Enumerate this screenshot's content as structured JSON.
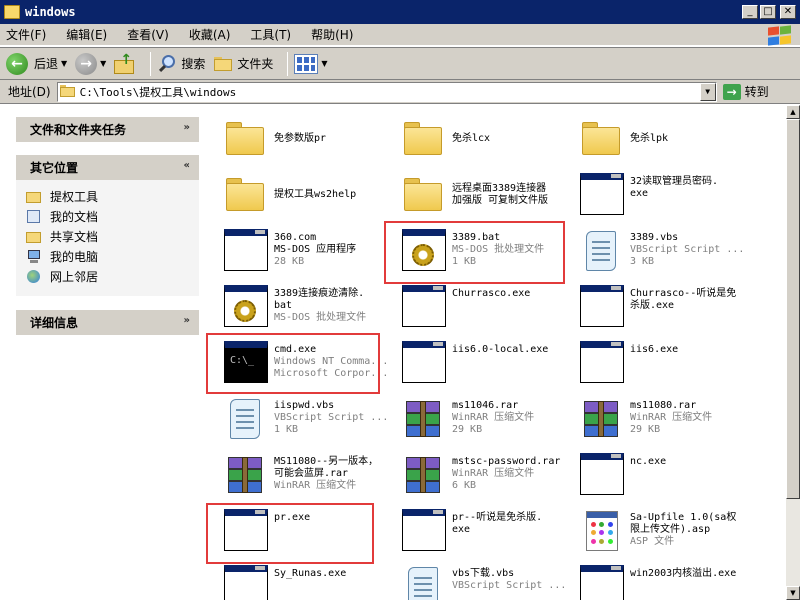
{
  "window": {
    "title": "windows"
  },
  "menu": [
    "文件(F)",
    "编辑(E)",
    "查看(V)",
    "收藏(A)",
    "工具(T)",
    "帮助(H)"
  ],
  "toolbar": {
    "back_label": "后退",
    "search_label": "搜索",
    "folders_label": "文件夹"
  },
  "address": {
    "label": "地址(D)",
    "value": "C:\\Tools\\提权工具\\windows",
    "go_label": "转到"
  },
  "taskpane": {
    "tasks_title": "文件和文件夹任务",
    "places_title": "其它位置",
    "places": [
      {
        "label": "提权工具",
        "icon": "folder-icon"
      },
      {
        "label": "我的文档",
        "icon": "documents-icon"
      },
      {
        "label": "共享文档",
        "icon": "folder-icon"
      },
      {
        "label": "我的电脑",
        "icon": "computer-icon"
      },
      {
        "label": "网上邻居",
        "icon": "network-icon"
      }
    ],
    "details_title": "详细信息"
  },
  "files": [
    {
      "name": "免参数版pr",
      "line2": "",
      "line3": "",
      "type": "folder"
    },
    {
      "name": "免杀lcx",
      "line2": "",
      "line3": "",
      "type": "folder"
    },
    {
      "name": "免杀lpk",
      "line2": "",
      "line3": "",
      "type": "folder"
    },
    {
      "name": "提权工具ws2help",
      "line2": "",
      "line3": "",
      "type": "folder"
    },
    {
      "name": "远程桌面3389连接器",
      "line2": "加强版 可复制文件版",
      "line3": "",
      "type": "folder"
    },
    {
      "name": "32读取管理员密码.",
      "line2": "exe",
      "line3": "",
      "type": "exe"
    },
    {
      "name": "360.com",
      "line2": "MS-DOS 应用程序",
      "line3": "28 KB",
      "type": "exe"
    },
    {
      "name": "3389.bat",
      "line2": "MS-DOS 批处理文件",
      "line3": "1 KB",
      "type": "bat"
    },
    {
      "name": "3389.vbs",
      "line2": "VBScript Script ...",
      "line3": "3 KB",
      "type": "vbs"
    },
    {
      "name": "3389连接痕迹清除.",
      "line2": "bat",
      "line3": "MS-DOS 批处理文件",
      "type": "bat"
    },
    {
      "name": "Churrasco.exe",
      "line2": "",
      "line3": "",
      "type": "exe"
    },
    {
      "name": "Churrasco--听说是免",
      "line2": "杀版.exe",
      "line3": "",
      "type": "exe"
    },
    {
      "name": "cmd.exe",
      "line2": "Windows NT Comma...",
      "line3": "Microsoft Corpor...",
      "type": "cmd"
    },
    {
      "name": "iis6.0-local.exe",
      "line2": "",
      "line3": "",
      "type": "exe"
    },
    {
      "name": "iis6.exe",
      "line2": "",
      "line3": "",
      "type": "exe"
    },
    {
      "name": "iispwd.vbs",
      "line2": "VBScript Script ...",
      "line3": "1 KB",
      "type": "vbs"
    },
    {
      "name": "ms11046.rar",
      "line2": "WinRAR 压缩文件",
      "line3": "29 KB",
      "type": "rar"
    },
    {
      "name": "ms11080.rar",
      "line2": "WinRAR 压缩文件",
      "line3": "29 KB",
      "type": "rar"
    },
    {
      "name": "MS11080--另一版本，",
      "line2": "可能会蓝屏.rar",
      "line3": "WinRAR 压缩文件",
      "type": "rar"
    },
    {
      "name": "mstsc-password.rar",
      "line2": "WinRAR 压缩文件",
      "line3": "6 KB",
      "type": "rar"
    },
    {
      "name": "nc.exe",
      "line2": "",
      "line3": "",
      "type": "exe"
    },
    {
      "name": "pr.exe",
      "line2": "",
      "line3": "",
      "type": "exe"
    },
    {
      "name": "pr--听说是免杀版.",
      "line2": "exe",
      "line3": "",
      "type": "exe"
    },
    {
      "name": "Sa-Upfile 1.0(sa权",
      "line2": "限上传文件).asp",
      "line3": "ASP 文件",
      "type": "asp"
    },
    {
      "name": "Sy_Runas.exe",
      "line2": "",
      "line3": "",
      "type": "exe"
    },
    {
      "name": "vbs下载.vbs",
      "line2": "VBScript Script ...",
      "line3": "",
      "type": "vbs"
    },
    {
      "name": "win2003内核溢出.exe",
      "line2": "",
      "line3": "",
      "type": "exe"
    }
  ],
  "colors": {
    "titlebar": "#0a246a",
    "chrome": "#d4d0c8",
    "highlight_box": "#e23b3b"
  }
}
